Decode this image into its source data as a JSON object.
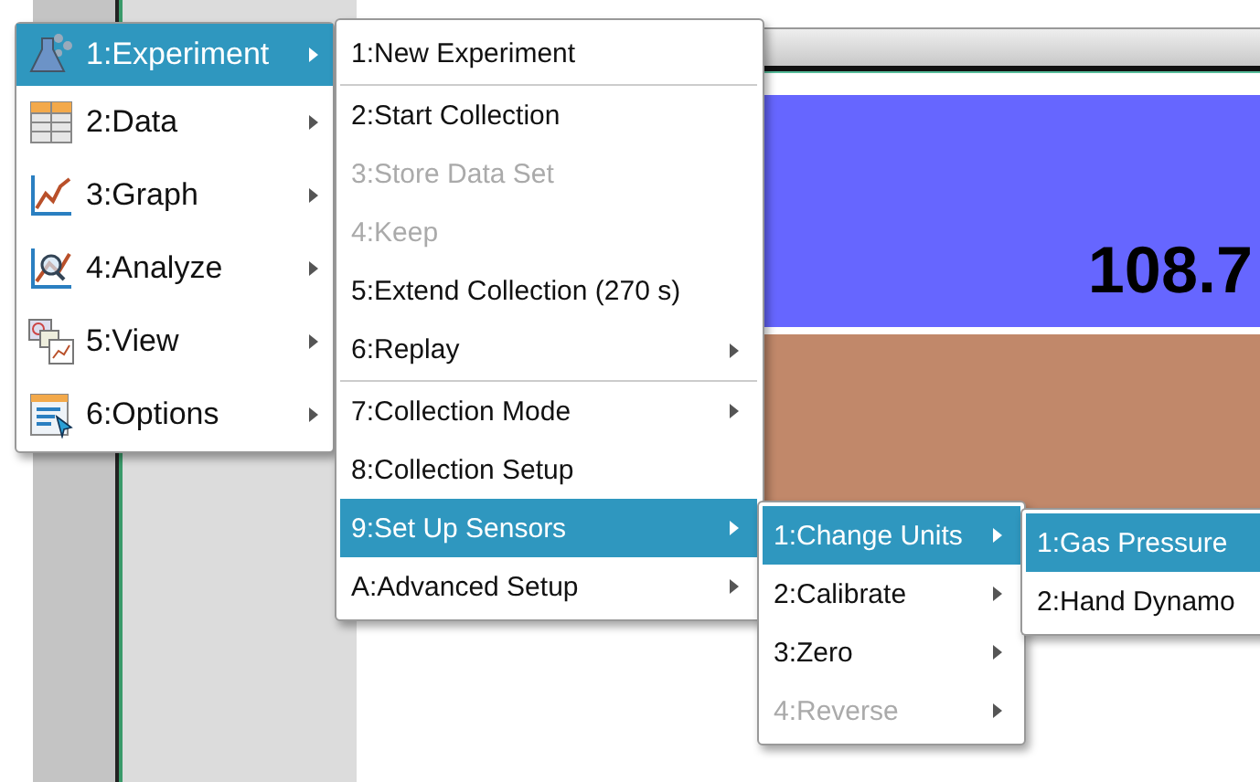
{
  "meter": {
    "reading": "108.7"
  },
  "main_menu": {
    "items": [
      {
        "label": "1:Experiment",
        "selected": true,
        "submenu": true
      },
      {
        "label": "2:Data",
        "selected": false,
        "submenu": true
      },
      {
        "label": "3:Graph",
        "selected": false,
        "submenu": true
      },
      {
        "label": "4:Analyze",
        "selected": false,
        "submenu": true
      },
      {
        "label": "5:View",
        "selected": false,
        "submenu": true
      },
      {
        "label": "6:Options",
        "selected": false,
        "submenu": true
      }
    ]
  },
  "experiment_menu": {
    "items": [
      {
        "label": "1:New Experiment",
        "selected": false,
        "disabled": false,
        "submenu": false,
        "divider_after": true
      },
      {
        "label": "2:Start Collection",
        "selected": false,
        "disabled": false,
        "submenu": false,
        "divider_after": false
      },
      {
        "label": "3:Store Data Set",
        "selected": false,
        "disabled": true,
        "submenu": false,
        "divider_after": false
      },
      {
        "label": "4:Keep",
        "selected": false,
        "disabled": true,
        "submenu": false,
        "divider_after": false
      },
      {
        "label": "5:Extend Collection (270 s)",
        "selected": false,
        "disabled": false,
        "submenu": false,
        "divider_after": false
      },
      {
        "label": "6:Replay",
        "selected": false,
        "disabled": false,
        "submenu": true,
        "divider_after": true
      },
      {
        "label": "7:Collection Mode",
        "selected": false,
        "disabled": false,
        "submenu": true,
        "divider_after": false
      },
      {
        "label": "8:Collection Setup",
        "selected": false,
        "disabled": false,
        "submenu": false,
        "divider_after": false
      },
      {
        "label": "9:Set Up Sensors",
        "selected": true,
        "disabled": false,
        "submenu": true,
        "divider_after": false
      },
      {
        "label": "A:Advanced Setup",
        "selected": false,
        "disabled": false,
        "submenu": true,
        "divider_after": false
      }
    ]
  },
  "sensors_menu": {
    "items": [
      {
        "label": "1:Change Units",
        "selected": true,
        "disabled": false,
        "submenu": true
      },
      {
        "label": "2:Calibrate",
        "selected": false,
        "disabled": false,
        "submenu": true
      },
      {
        "label": "3:Zero",
        "selected": false,
        "disabled": false,
        "submenu": true
      },
      {
        "label": "4:Reverse",
        "selected": false,
        "disabled": true,
        "submenu": true
      }
    ]
  },
  "units_menu": {
    "items": [
      {
        "label": "1:Gas Pressure",
        "selected": true
      },
      {
        "label": "2:Hand Dynamo",
        "selected": false
      }
    ]
  }
}
